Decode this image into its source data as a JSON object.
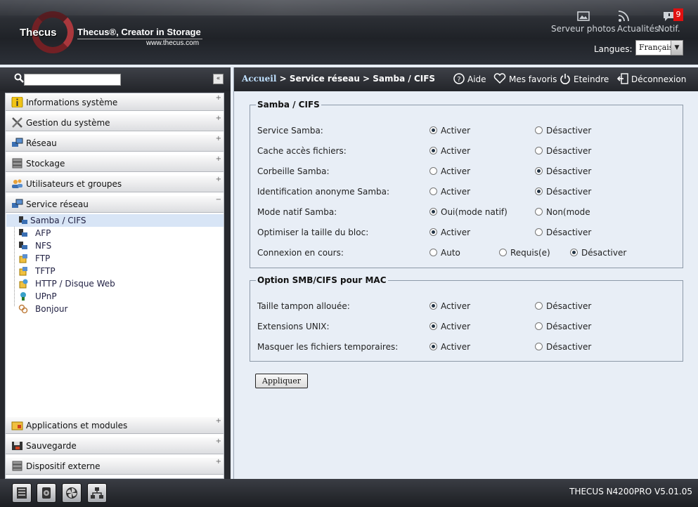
{
  "header": {
    "brand": "Thecus",
    "tagline": "Thecus®, Creator in Storage",
    "url": "www.thecus.com",
    "photos_label": "Serveur photos",
    "news_label": "Actualités",
    "notif_label": "Notif.",
    "notif_count": "9",
    "language_label": "Langues:",
    "language_value": "Français"
  },
  "search": {
    "placeholder": "",
    "collapse": "«"
  },
  "sidebar": {
    "categories_top": [
      {
        "label": "Informations système",
        "icon": "info-icon"
      },
      {
        "label": "Gestion du système",
        "icon": "tools-icon"
      },
      {
        "label": "Réseau",
        "icon": "network-icon"
      },
      {
        "label": "Stockage",
        "icon": "storage-icon"
      },
      {
        "label": "Utilisateurs et groupes",
        "icon": "users-icon"
      },
      {
        "label": "Service réseau",
        "icon": "network-service-icon"
      }
    ],
    "sub_items": [
      {
        "label": "Samba / CIFS",
        "icon": "samba-icon"
      },
      {
        "label": "AFP",
        "icon": "afp-icon"
      },
      {
        "label": "NFS",
        "icon": "nfs-icon"
      },
      {
        "label": "FTP",
        "icon": "ftp-icon"
      },
      {
        "label": "TFTP",
        "icon": "tftp-icon"
      },
      {
        "label": "HTTP / Disque Web",
        "icon": "http-icon"
      },
      {
        "label": "UPnP",
        "icon": "upnp-icon"
      },
      {
        "label": "Bonjour",
        "icon": "bonjour-icon"
      }
    ],
    "categories_bottom": [
      {
        "label": "Applications et modules",
        "icon": "apps-icon"
      },
      {
        "label": "Sauvegarde",
        "icon": "backup-icon"
      },
      {
        "label": "Dispositif externe",
        "icon": "external-device-icon"
      }
    ],
    "plus": "+",
    "minus": "−"
  },
  "breadcrumb": {
    "home": "Accueil",
    "path": " > Service réseau > Samba / CIFS",
    "help": "Aide",
    "favorites": "Mes favoris",
    "shutdown": "Eteindre",
    "logout": "Déconnexion"
  },
  "samba": {
    "legend": "Samba / CIFS",
    "rows": [
      {
        "label": "Service Samba:",
        "opt1": "Activer",
        "opt2": "Désactiver",
        "selected": 1
      },
      {
        "label": "Cache accès fichiers:",
        "opt1": "Activer",
        "opt2": "Désactiver",
        "selected": 1
      },
      {
        "label": "Corbeille Samba:",
        "opt1": "Activer",
        "opt2": "Désactiver",
        "selected": 2
      },
      {
        "label": "Identification anonyme Samba:",
        "opt1": "Activer",
        "opt2": "Désactiver",
        "selected": 2
      },
      {
        "label": "Mode natif Samba:",
        "opt1": "Oui(mode natif)",
        "opt2": "Non(mode",
        "selected": 1
      },
      {
        "label": "Optimiser la taille du bloc:",
        "opt1": "Activer",
        "opt2": "Désactiver",
        "selected": 1
      }
    ],
    "conn_label": "Connexion en cours:",
    "conn_opt1": "Auto",
    "conn_opt2": "Requis(e)",
    "conn_opt3": "Désactiver",
    "conn_selected": 3
  },
  "mac": {
    "legend": "Option SMB/CIFS pour MAC",
    "rows": [
      {
        "label": "Taille tampon allouée:",
        "opt1": "Activer",
        "opt2": "Désactiver",
        "selected": 1
      },
      {
        "label": "Extensions UNIX:",
        "opt1": "Activer",
        "opt2": "Désactiver",
        "selected": 1
      },
      {
        "label": "Masquer les fichiers temporaires:",
        "opt1": "Activer",
        "opt2": "Désactiver",
        "selected": 1
      }
    ]
  },
  "apply_label": "Appliquer",
  "footer": {
    "version": "THECUS N4200PRO V5.01.05",
    "dock_icons": [
      "server-icon",
      "disk-icon",
      "fan-icon",
      "network-topology-icon"
    ]
  }
}
